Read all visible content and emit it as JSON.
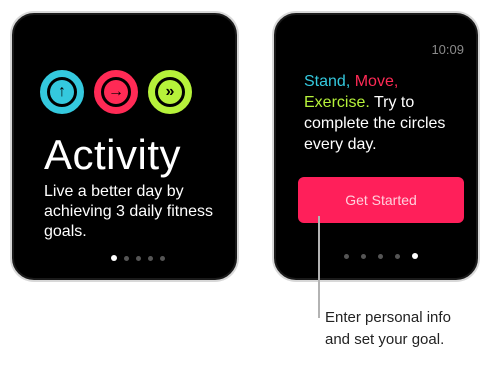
{
  "colors": {
    "stand": "#34c9de",
    "move": "#ff2a55",
    "exercise": "#b6f23a",
    "button": "#ff1f5a"
  },
  "left_screen": {
    "icons": [
      "stand-ring-icon",
      "move-ring-icon",
      "exercise-ring-icon"
    ],
    "title": "Activity",
    "description": "Live a better day by achieving 3 daily fitness goals.",
    "page_indicator": {
      "total": 5,
      "current": 1
    }
  },
  "right_screen": {
    "time": "10:09",
    "goal_text": {
      "stand": "Stand,",
      "move": "Move,",
      "exercise": "Exercise.",
      "rest": " Try to complete the circles every day."
    },
    "button_label": "Get Started",
    "page_indicator": {
      "total": 5,
      "current": 5
    }
  },
  "callout": {
    "text": "Enter personal info and set your goal."
  }
}
